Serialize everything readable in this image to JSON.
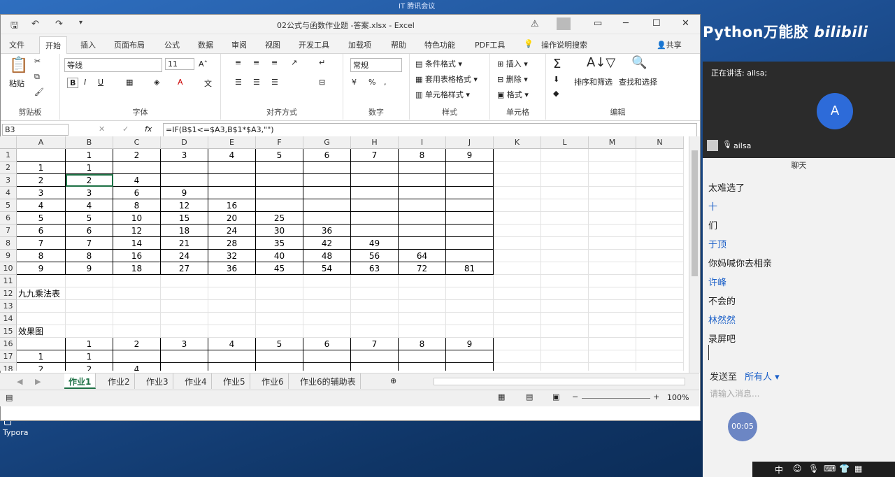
{
  "desktop": {
    "brand": "Python万能胶",
    "brand2": "bilibili",
    "top_note": "IT 腾讯会议",
    "typora": "Typora"
  },
  "excel": {
    "title": "02公式与函数作业题 -答案.xlsx  -  Excel",
    "tabs": [
      "文件",
      "开始",
      "插入",
      "页面布局",
      "公式",
      "数据",
      "审阅",
      "视图",
      "开发工具",
      "加载项",
      "帮助",
      "特色功能",
      "PDF工具"
    ],
    "tell_me": "操作说明搜索",
    "share": "共享",
    "ribbon": {
      "paste": "粘贴",
      "font_name": "等线",
      "font_size": "11",
      "number_format": "常规",
      "cond_format": "条件格式",
      "table_format": "套用表格格式",
      "cell_style": "单元格样式",
      "insert": "插入",
      "delete": "删除",
      "format": "格式",
      "sort_filter": "排序和筛选",
      "find_select": "查找和选择",
      "groups": [
        "剪贴板",
        "字体",
        "对齐方式",
        "数字",
        "样式",
        "单元格",
        "编辑"
      ]
    },
    "name_box": "B3",
    "formula": "=IF(B$1<=$A3,B$1*$A3,\"\")",
    "columns": [
      "A",
      "B",
      "C",
      "D",
      "E",
      "F",
      "G",
      "H",
      "I",
      "J",
      "K",
      "L",
      "M",
      "N"
    ],
    "rows": [
      [
        "",
        "1",
        "2",
        "3",
        "4",
        "5",
        "6",
        "7",
        "8",
        "9"
      ],
      [
        "1",
        "1",
        "",
        "",
        "",
        "",
        "",
        "",
        "",
        ""
      ],
      [
        "2",
        "2",
        "4",
        "",
        "",
        "",
        "",
        "",
        "",
        ""
      ],
      [
        "3",
        "3",
        "6",
        "9",
        "",
        "",
        "",
        "",
        "",
        ""
      ],
      [
        "4",
        "4",
        "8",
        "12",
        "16",
        "",
        "",
        "",
        "",
        ""
      ],
      [
        "5",
        "5",
        "10",
        "15",
        "20",
        "25",
        "",
        "",
        "",
        ""
      ],
      [
        "6",
        "6",
        "12",
        "18",
        "24",
        "30",
        "36",
        "",
        "",
        ""
      ],
      [
        "7",
        "7",
        "14",
        "21",
        "28",
        "35",
        "42",
        "49",
        "",
        ""
      ],
      [
        "8",
        "8",
        "16",
        "24",
        "32",
        "40",
        "48",
        "56",
        "64",
        ""
      ],
      [
        "9",
        "9",
        "18",
        "27",
        "36",
        "45",
        "54",
        "63",
        "72",
        "81"
      ],
      [
        "",
        "",
        "",
        "",
        "",
        "",
        "",
        "",
        "",
        ""
      ],
      [
        "九九乘法表",
        "",
        "",
        "",
        "",
        "",
        "",
        "",
        "",
        ""
      ],
      [
        "",
        "",
        "",
        "",
        "",
        "",
        "",
        "",
        "",
        ""
      ],
      [
        "",
        "",
        "",
        "",
        "",
        "",
        "",
        "",
        "",
        ""
      ],
      [
        "效果图",
        "",
        "",
        "",
        "",
        "",
        "",
        "",
        "",
        ""
      ],
      [
        "",
        "1",
        "2",
        "3",
        "4",
        "5",
        "6",
        "7",
        "8",
        "9"
      ],
      [
        "1",
        "1",
        "",
        "",
        "",
        "",
        "",
        "",
        "",
        ""
      ],
      [
        "2",
        "2",
        "4",
        "",
        "",
        "",
        "",
        "",
        "",
        ""
      ]
    ],
    "row_numbers": [
      "1",
      "2",
      "3",
      "4",
      "5",
      "6",
      "7",
      "8",
      "9",
      "10",
      "11",
      "12",
      "13",
      "14",
      "15",
      "16",
      "17",
      "18"
    ],
    "sheets": [
      "作业1",
      "作业2",
      "作业3",
      "作业4",
      "作业5",
      "作业6",
      "作业6的辅助表"
    ],
    "zoom": "100%"
  },
  "meeting": {
    "speaking": "正在讲话: ailsa;",
    "avatar": "A",
    "user": "ailsa",
    "chat_title": "聊天",
    "messages": [
      {
        "text": "太难选了",
        "kind": "msg"
      },
      {
        "text": "十",
        "kind": "name"
      },
      {
        "text": "们",
        "kind": "msg"
      },
      {
        "text": "于顶",
        "kind": "name"
      },
      {
        "text": "你妈喊你去相亲",
        "kind": "msg"
      },
      {
        "text": "许峰",
        "kind": "name"
      },
      {
        "text": "不会的",
        "kind": "msg"
      },
      {
        "text": "林然然",
        "kind": "name"
      },
      {
        "text": "录屏吧",
        "kind": "msg"
      }
    ],
    "send_to": "发送至",
    "recipient": "所有人",
    "input_placeholder": "请输入消息...",
    "timer": "00:05",
    "ime": "中"
  }
}
